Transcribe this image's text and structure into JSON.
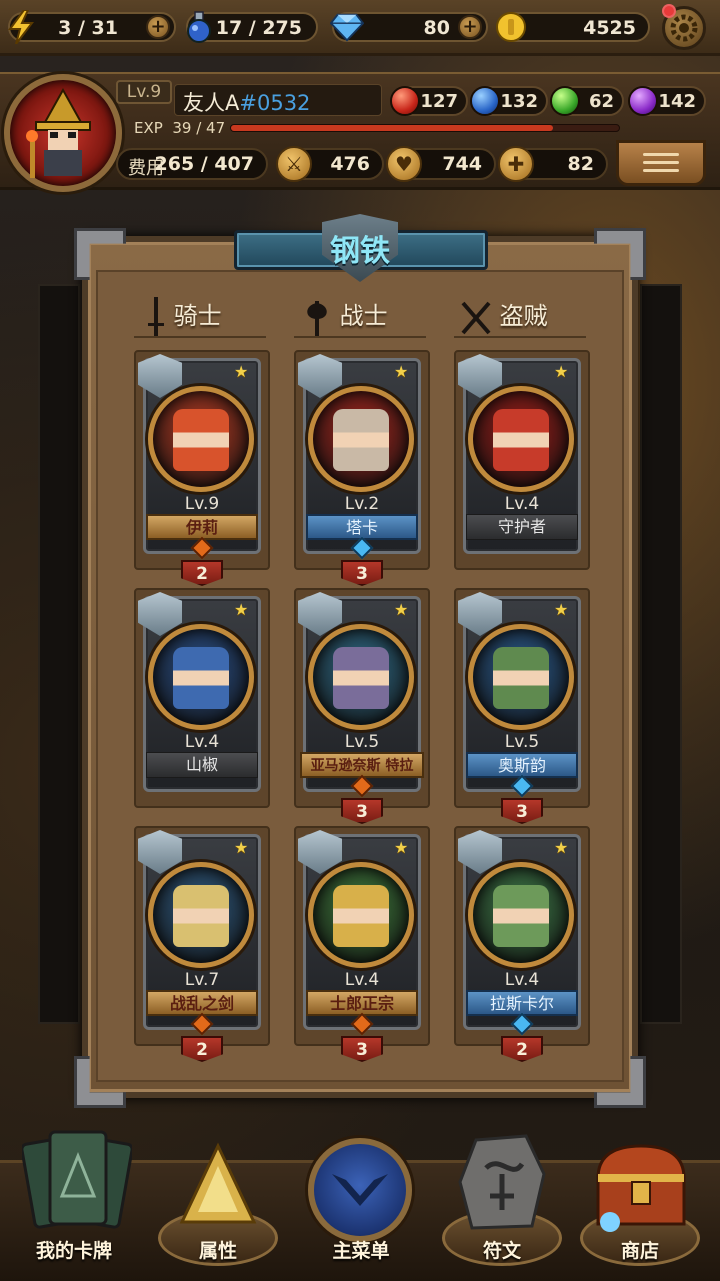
{
  "resources": {
    "stamina": "3 / 31",
    "potions": "17 / 275",
    "gems": "80",
    "gold": "4525"
  },
  "profile": {
    "level": "Lv.9",
    "name": "友人A",
    "id": "#0532",
    "exp_label": "EXP",
    "exp_value": "39 / 47",
    "exp_fraction": 0.83,
    "orbs": {
      "red": "127",
      "blue": "132",
      "green": "62",
      "purple": "142"
    },
    "cost_label": "费用",
    "cost_value": "265 / 407",
    "attack": "476",
    "hp": "744",
    "heal": "82"
  },
  "deck": {
    "title": "钢铁",
    "columns": [
      {
        "label": "骑士",
        "icon": "sword-icon"
      },
      {
        "label": "战士",
        "icon": "axe-icon"
      },
      {
        "label": "盗贼",
        "icon": "crossed-blades-icon"
      }
    ],
    "cards": [
      {
        "level": "Lv.9",
        "name": "伊莉",
        "cost": "2",
        "banner": "gold",
        "rarity": "gold",
        "portrait_bg": "#b33a22",
        "figure": "#d8532c"
      },
      {
        "level": "Lv.2",
        "name": "塔卡",
        "cost": "3",
        "banner": "blue",
        "rarity": "blue",
        "portrait_bg": "#a3261d",
        "figure": "#c9b9a6"
      },
      {
        "level": "Lv.4",
        "name": "守护者",
        "cost": "",
        "banner": "gray",
        "rarity": "none",
        "portrait_bg": "#9a1d18",
        "figure": "#c73b2a"
      },
      {
        "level": "Lv.4",
        "name": "山椒",
        "cost": "",
        "banner": "gray",
        "rarity": "none",
        "portrait_bg": "#2a4f86",
        "figure": "#3e6ab0"
      },
      {
        "level": "Lv.5",
        "name": "亚马逊奈斯 特拉",
        "cost": "3",
        "banner": "gold",
        "rarity": "gold",
        "portrait_bg": "#2f6a86",
        "figure": "#7a6d9a"
      },
      {
        "level": "Lv.5",
        "name": "奥斯韵",
        "cost": "3",
        "banner": "blue",
        "rarity": "blue",
        "portrait_bg": "#2a5a8c",
        "figure": "#5f8a4f"
      },
      {
        "level": "Lv.7",
        "name": "战乱之剑",
        "cost": "2",
        "banner": "gold",
        "rarity": "gold",
        "portrait_bg": "#2f5a80",
        "figure": "#d9c070"
      },
      {
        "level": "Lv.4",
        "name": "士郎正宗",
        "cost": "3",
        "banner": "gold",
        "rarity": "gold",
        "portrait_bg": "#3f7a3c",
        "figure": "#d8b04a"
      },
      {
        "level": "Lv.4",
        "name": "拉斯卡尔",
        "cost": "2",
        "banner": "blue",
        "rarity": "blue",
        "portrait_bg": "#3e7a48",
        "figure": "#6d9a5a"
      }
    ]
  },
  "nav": [
    {
      "label": "我的卡牌",
      "icon": "card-deck-icon"
    },
    {
      "label": "属性",
      "icon": "triangle-crystal-icon"
    },
    {
      "label": "主菜单",
      "icon": "emblem-icon"
    },
    {
      "label": "符文",
      "icon": "rune-stone-icon"
    },
    {
      "label": "商店",
      "icon": "treasure-chest-icon"
    }
  ],
  "colors": {
    "accent_gold": "#c08a3c",
    "exp_bar": "#c7391f",
    "player_id": "#4aa0e0",
    "title_text": "#8fe6f6"
  }
}
